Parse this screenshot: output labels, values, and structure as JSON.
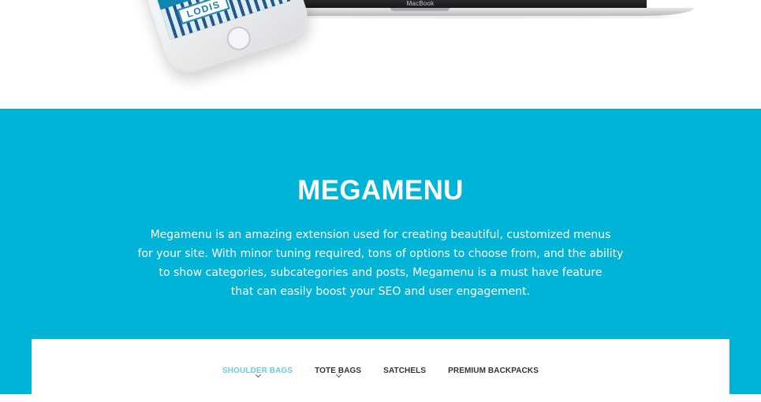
{
  "hero": {
    "laptop_brand": "MacBook",
    "phone_screen_label": "LODIS"
  },
  "feature": {
    "title": "MEGAMENU",
    "description_lines": [
      "Megamenu is an amazing extension used for creating beautiful, customized menus",
      "for your site. With minor tuning required, tons of options to choose from, and the ability",
      "to show categories, subcategories and posts, Megamenu is a must have feature",
      "that can easily boost your SEO and user engagement."
    ],
    "background_color": "#00b4d8"
  },
  "menu": {
    "items": [
      {
        "label": "SHOULDER BAGS",
        "has_dropdown": true,
        "active": true
      },
      {
        "label": "TOTE BAGS",
        "has_dropdown": true,
        "active": false
      },
      {
        "label": "SATCHELS",
        "has_dropdown": false,
        "active": false
      },
      {
        "label": "PREMIUM BACKPACKS",
        "has_dropdown": false,
        "active": false
      }
    ],
    "active_color": "#6ec9e3",
    "icon": "chevron-down-icon"
  }
}
